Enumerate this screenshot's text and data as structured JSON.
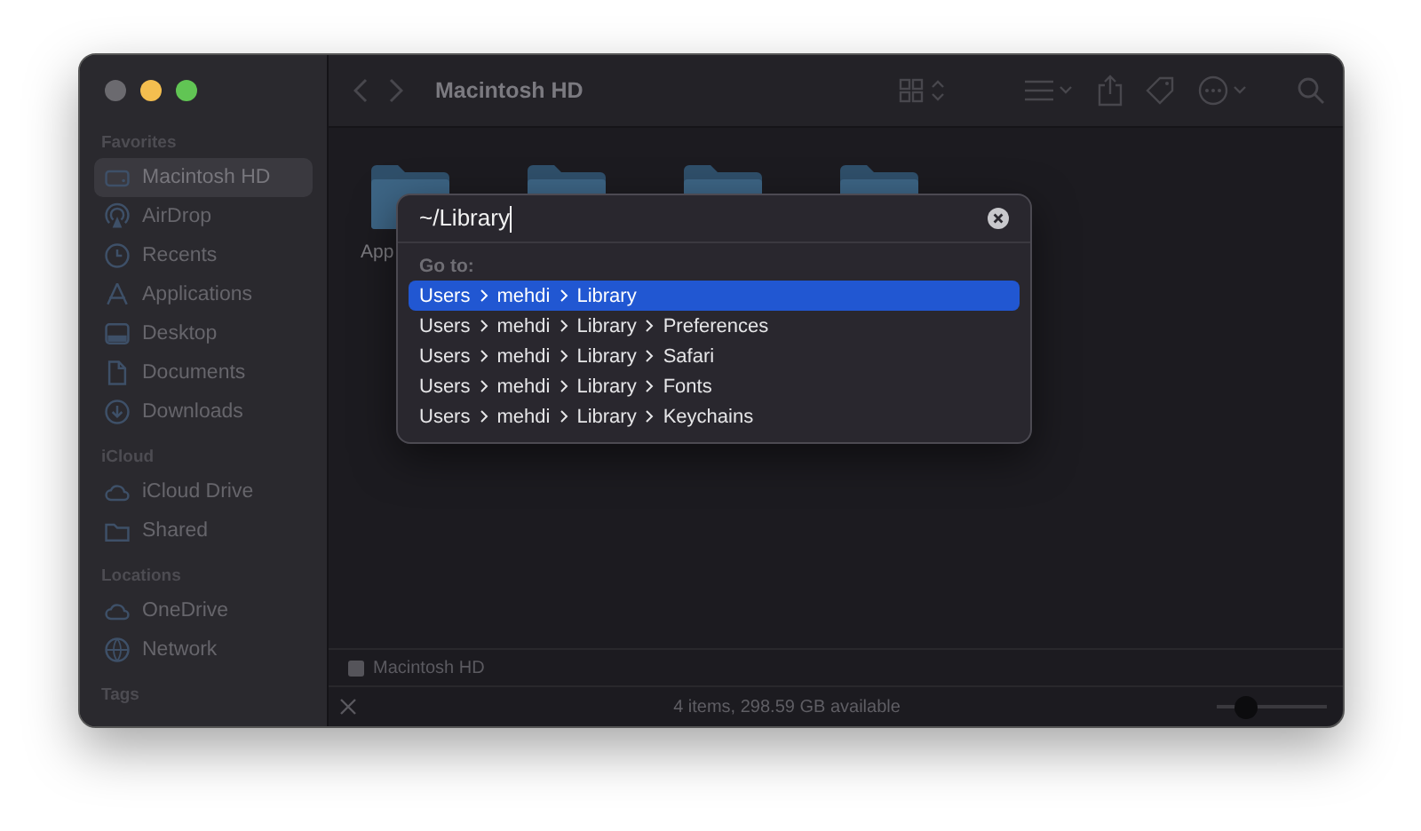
{
  "window": {
    "title": "Macintosh HD"
  },
  "sidebar": {
    "sections": [
      {
        "heading": "Favorites",
        "items": [
          {
            "label": "Macintosh HD",
            "selected": true
          },
          {
            "label": "AirDrop",
            "selected": false
          },
          {
            "label": "Recents",
            "selected": false
          },
          {
            "label": "Applications",
            "selected": false
          },
          {
            "label": "Desktop",
            "selected": false
          },
          {
            "label": "Documents",
            "selected": false
          },
          {
            "label": "Downloads",
            "selected": false
          }
        ]
      },
      {
        "heading": "iCloud",
        "items": [
          {
            "label": "iCloud Drive",
            "selected": false
          },
          {
            "label": "Shared",
            "selected": false
          }
        ]
      },
      {
        "heading": "Locations",
        "items": [
          {
            "label": "OneDrive",
            "selected": false
          },
          {
            "label": "Network",
            "selected": false
          }
        ]
      },
      {
        "heading": "Tags"
      }
    ]
  },
  "folders": [
    {
      "kind": "folder",
      "label": "App"
    },
    {
      "kind": "folder"
    },
    {
      "kind": "folder"
    },
    {
      "kind": "folder"
    }
  ],
  "go_to_dialog": {
    "value": "~/Library",
    "heading": "Go to:",
    "suggestions": [
      {
        "segments": [
          "Users",
          "mehdi",
          "Library"
        ],
        "selected": true
      },
      {
        "segments": [
          "Users",
          "mehdi",
          "Library",
          "Preferences"
        ],
        "selected": false
      },
      {
        "segments": [
          "Users",
          "mehdi",
          "Library",
          "Safari"
        ],
        "selected": false
      },
      {
        "segments": [
          "Users",
          "mehdi",
          "Library",
          "Fonts"
        ],
        "selected": false
      },
      {
        "segments": [
          "Users",
          "mehdi",
          "Library",
          "Keychains"
        ],
        "selected": false
      }
    ]
  },
  "path_bar": {
    "label": "Macintosh HD"
  },
  "status_bar": {
    "text": "4 items, 298.59 GB available",
    "zoom": {
      "level": 0.25
    }
  }
}
